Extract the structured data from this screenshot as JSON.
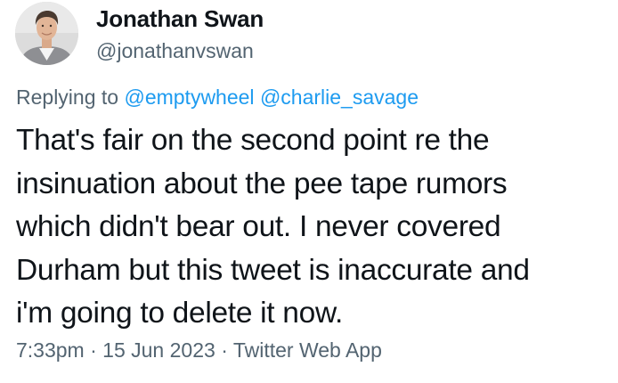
{
  "tweet": {
    "author": {
      "name": "Jonathan Swan",
      "handle": "@jonathanvswan",
      "avatar_icon": "user-avatar"
    },
    "reply": {
      "prefix": "Replying to",
      "mentions": [
        "@emptywheel",
        "@charlie_savage"
      ]
    },
    "text_lines": [
      "That's fair on the second point re the",
      "insinuation about the pee tape rumors",
      "which didn't bear out. I never covered",
      "Durham but this tweet is inaccurate and",
      "i'm going to delete it now."
    ],
    "meta": {
      "time": "7:33pm",
      "separator": "·",
      "date": "15 Jun 2023",
      "source": "Twitter Web App"
    },
    "colors": {
      "text": "#0f1419",
      "secondary": "#536471",
      "link": "#1d9bf0"
    }
  }
}
